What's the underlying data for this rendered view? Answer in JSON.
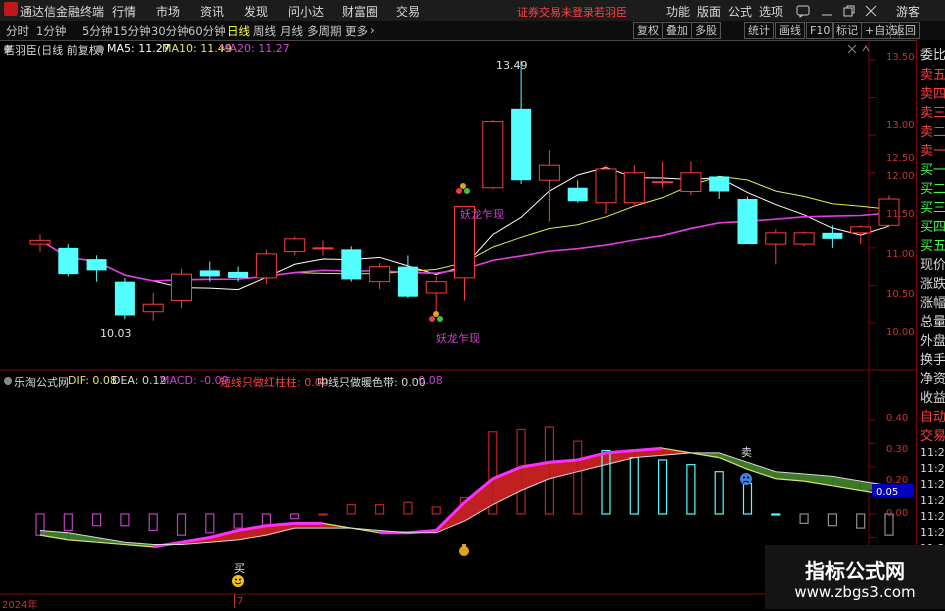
{
  "menu": {
    "app_title": "通达信金融终端",
    "items": [
      "行情",
      "市场",
      "资讯",
      "发现",
      "问小达",
      "财富圈",
      "交易"
    ],
    "login_warning": "证券交易未登录",
    "stock_name": "若羽臣",
    "right_items": [
      "功能",
      "版面",
      "公式",
      "选项"
    ],
    "user": "游客"
  },
  "toolbar": {
    "periods": [
      "分时",
      "1分钟",
      "5分钟",
      "15分钟",
      "30分钟",
      "60分钟",
      "日线",
      "周线",
      "月线",
      "多周期",
      "更多"
    ],
    "active": "日线",
    "buttons": [
      "复权",
      "叠加",
      "多股",
      "统计",
      "画线",
      "F10",
      "标记",
      "+自选",
      "返回"
    ]
  },
  "main_chart": {
    "header_name": "若羽臣(日线 前复权)",
    "ma5": "MA5: 11.27",
    "ma10": "MA10: 11.49",
    "ma20": "MA20: 11.27",
    "high_label": "13.49",
    "low_label": "10.03",
    "signal_text_1": "妖龙乍现",
    "signal_text_2": "妖龙乍现",
    "price_ticks": [
      "13.50",
      "13.00",
      "12.50",
      "12.00",
      "11.50",
      "11.00",
      "10.50",
      "10.00"
    ]
  },
  "indicator": {
    "name": "乐淘公式网",
    "dif": "DIF: 0.08",
    "dea": "DEA: 0.12",
    "macd": "MACD: -0.09",
    "red_bar": "短线只做红柱柱: 0.00",
    "warm_band": "中线只做暖色带: 0.00",
    "extra_val": ": 0.08",
    "ticks": [
      "0.40",
      "0.30",
      "0.20",
      "0.10",
      "0.00",
      "-0.10"
    ],
    "current_value": "0.05",
    "buy_label": "买",
    "sell_label": "卖"
  },
  "time_axis": {
    "year": "2024年",
    "month": "7"
  },
  "right_panel": {
    "items": [
      "委比",
      "卖五",
      "卖四",
      "卖三",
      "卖二",
      "卖一",
      "买一",
      "买二",
      "买三",
      "买四",
      "买五",
      "现价",
      "涨跌",
      "涨幅",
      "总量",
      "外盘",
      "换手",
      "净资",
      "收益",
      "自动",
      "交易"
    ],
    "times": [
      "11:28",
      "11:29",
      "11:29",
      "11:29",
      "11:29",
      "11:29",
      "11:29",
      "11:29",
      "11:29",
      "11:29"
    ]
  },
  "watermark": {
    "title": "指标公式网",
    "url": "www.zbgs3.com"
  },
  "colors": {
    "up": "#ff3c3c",
    "down": "#54ffff",
    "ma5": "#ffffff",
    "ma10": "#e8e850",
    "ma20": "#e040e0",
    "macd_red": "#c02020",
    "macd_green": "#3a7a28"
  },
  "chart_data": {
    "type": "candlestick",
    "price_range": [
      9.75,
      13.6
    ],
    "candles": [
      {
        "o": 11.05,
        "h": 11.18,
        "l": 10.95,
        "c": 11.1
      },
      {
        "o": 11.0,
        "h": 11.05,
        "l": 10.62,
        "c": 10.65
      },
      {
        "o": 10.85,
        "h": 10.9,
        "l": 10.55,
        "c": 10.7
      },
      {
        "o": 10.55,
        "h": 10.6,
        "l": 10.05,
        "c": 10.1
      },
      {
        "o": 10.15,
        "h": 10.4,
        "l": 10.03,
        "c": 10.25
      },
      {
        "o": 10.3,
        "h": 10.72,
        "l": 10.2,
        "c": 10.65
      },
      {
        "o": 10.7,
        "h": 10.82,
        "l": 10.55,
        "c": 10.62
      },
      {
        "o": 10.68,
        "h": 10.75,
        "l": 10.55,
        "c": 10.6
      },
      {
        "o": 10.6,
        "h": 10.98,
        "l": 10.52,
        "c": 10.92
      },
      {
        "o": 10.95,
        "h": 11.15,
        "l": 10.9,
        "c": 11.12
      },
      {
        "o": 11.0,
        "h": 11.1,
        "l": 10.9,
        "c": 11.0
      },
      {
        "o": 10.98,
        "h": 11.02,
        "l": 10.55,
        "c": 10.58
      },
      {
        "o": 10.55,
        "h": 10.8,
        "l": 10.45,
        "c": 10.75
      },
      {
        "o": 10.75,
        "h": 10.9,
        "l": 10.33,
        "c": 10.35
      },
      {
        "o": 10.4,
        "h": 10.62,
        "l": 10.12,
        "c": 10.55
      },
      {
        "o": 10.6,
        "h": 11.55,
        "l": 10.3,
        "c": 11.55
      },
      {
        "o": 11.8,
        "h": 12.7,
        "l": 11.78,
        "c": 12.68
      },
      {
        "o": 12.85,
        "h": 13.49,
        "l": 11.85,
        "c": 11.9
      },
      {
        "o": 11.9,
        "h": 12.3,
        "l": 11.35,
        "c": 12.1
      },
      {
        "o": 11.8,
        "h": 11.9,
        "l": 11.6,
        "c": 11.62
      },
      {
        "o": 11.6,
        "h": 12.1,
        "l": 11.45,
        "c": 12.05
      },
      {
        "o": 11.6,
        "h": 12.1,
        "l": 11.55,
        "c": 12.0
      },
      {
        "o": 11.88,
        "h": 12.15,
        "l": 11.8,
        "c": 11.88
      },
      {
        "o": 11.75,
        "h": 12.15,
        "l": 11.7,
        "c": 12.0
      },
      {
        "o": 11.95,
        "h": 11.95,
        "l": 11.65,
        "c": 11.75
      },
      {
        "o": 11.65,
        "h": 11.68,
        "l": 11.05,
        "c": 11.05
      },
      {
        "o": 11.05,
        "h": 11.25,
        "l": 10.78,
        "c": 11.2
      },
      {
        "o": 11.05,
        "h": 11.22,
        "l": 11.02,
        "c": 11.2
      },
      {
        "o": 11.2,
        "h": 11.3,
        "l": 11.0,
        "c": 11.12
      },
      {
        "o": 11.2,
        "h": 11.3,
        "l": 11.05,
        "c": 11.28
      },
      {
        "o": 11.3,
        "h": 11.7,
        "l": 11.28,
        "c": 11.65
      }
    ],
    "macd_bars": [
      -0.09,
      -0.07,
      -0.05,
      -0.05,
      -0.07,
      -0.09,
      -0.08,
      -0.06,
      -0.05,
      -0.02,
      0.0,
      0.04,
      0.04,
      0.05,
      0.03,
      0.07,
      0.35,
      0.36,
      0.37,
      0.31,
      0.27,
      0.24,
      0.23,
      0.21,
      0.18,
      0.13,
      0.0,
      -0.04,
      -0.05,
      -0.06,
      -0.09
    ],
    "dif": [
      -0.09,
      -0.11,
      -0.12,
      -0.13,
      -0.14,
      -0.12,
      -0.1,
      -0.07,
      -0.05,
      -0.04,
      -0.04,
      -0.06,
      -0.08,
      -0.08,
      -0.07,
      0.05,
      0.15,
      0.2,
      0.22,
      0.23,
      0.26,
      0.27,
      0.28,
      0.26,
      0.24,
      0.19,
      0.15,
      0.14,
      0.12,
      0.1,
      0.08
    ],
    "dea": [
      -0.07,
      -0.08,
      -0.1,
      -0.12,
      -0.13,
      -0.13,
      -0.12,
      -0.11,
      -0.09,
      -0.06,
      -0.06,
      -0.06,
      -0.07,
      -0.08,
      -0.08,
      -0.03,
      0.04,
      0.1,
      0.15,
      0.18,
      0.21,
      0.24,
      0.25,
      0.26,
      0.26,
      0.22,
      0.18,
      0.17,
      0.16,
      0.14,
      0.12
    ],
    "macd_range": [
      -0.14,
      0.44
    ]
  }
}
